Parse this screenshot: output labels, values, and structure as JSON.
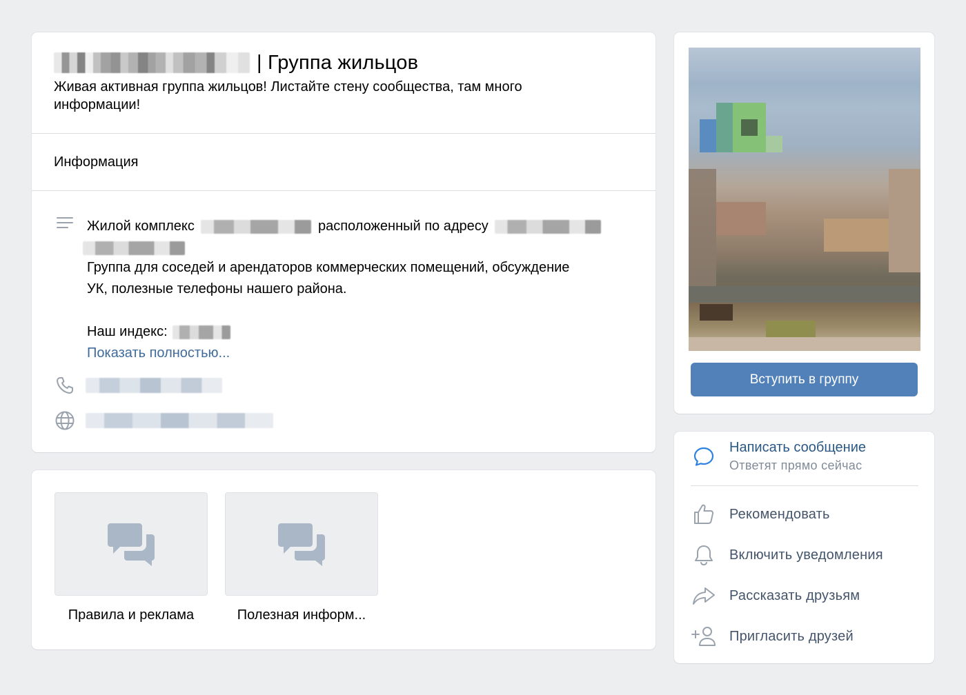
{
  "header": {
    "title": "| Группа жильцов",
    "subtitle": "Живая активная группа жильцов! Листайте стену сообщества, там много информации!"
  },
  "info": {
    "section_title": "Информация",
    "desc_part1": "Жилой комплекс",
    "desc_part2": "расположенный по адресу",
    "desc_line2": "Группа для соседей и арендаторов коммерческих помещений, обсуждение УК, полезные телефоны нашего района.",
    "index_label": "Наш индекс:",
    "show_more": "Показать полностью..."
  },
  "discussions": [
    {
      "label": "Правила и реклама"
    },
    {
      "label": "Полезная информ..."
    }
  ],
  "sidebar": {
    "join_button": "Вступить в группу",
    "message_title": "Написать сообщение",
    "message_sub": "Ответят прямо сейчас",
    "actions": [
      {
        "label": "Рекомендовать",
        "icon": "thumbs-up-icon"
      },
      {
        "label": "Включить уведомления",
        "icon": "bell-icon"
      },
      {
        "label": "Рассказать друзьям",
        "icon": "share-icon"
      },
      {
        "label": "Пригласить друзей",
        "icon": "add-user-icon"
      }
    ]
  },
  "colors": {
    "accent": "#5181b8",
    "link": "#2a5885",
    "icon": "#99a2ad",
    "background": "#edeef0"
  }
}
